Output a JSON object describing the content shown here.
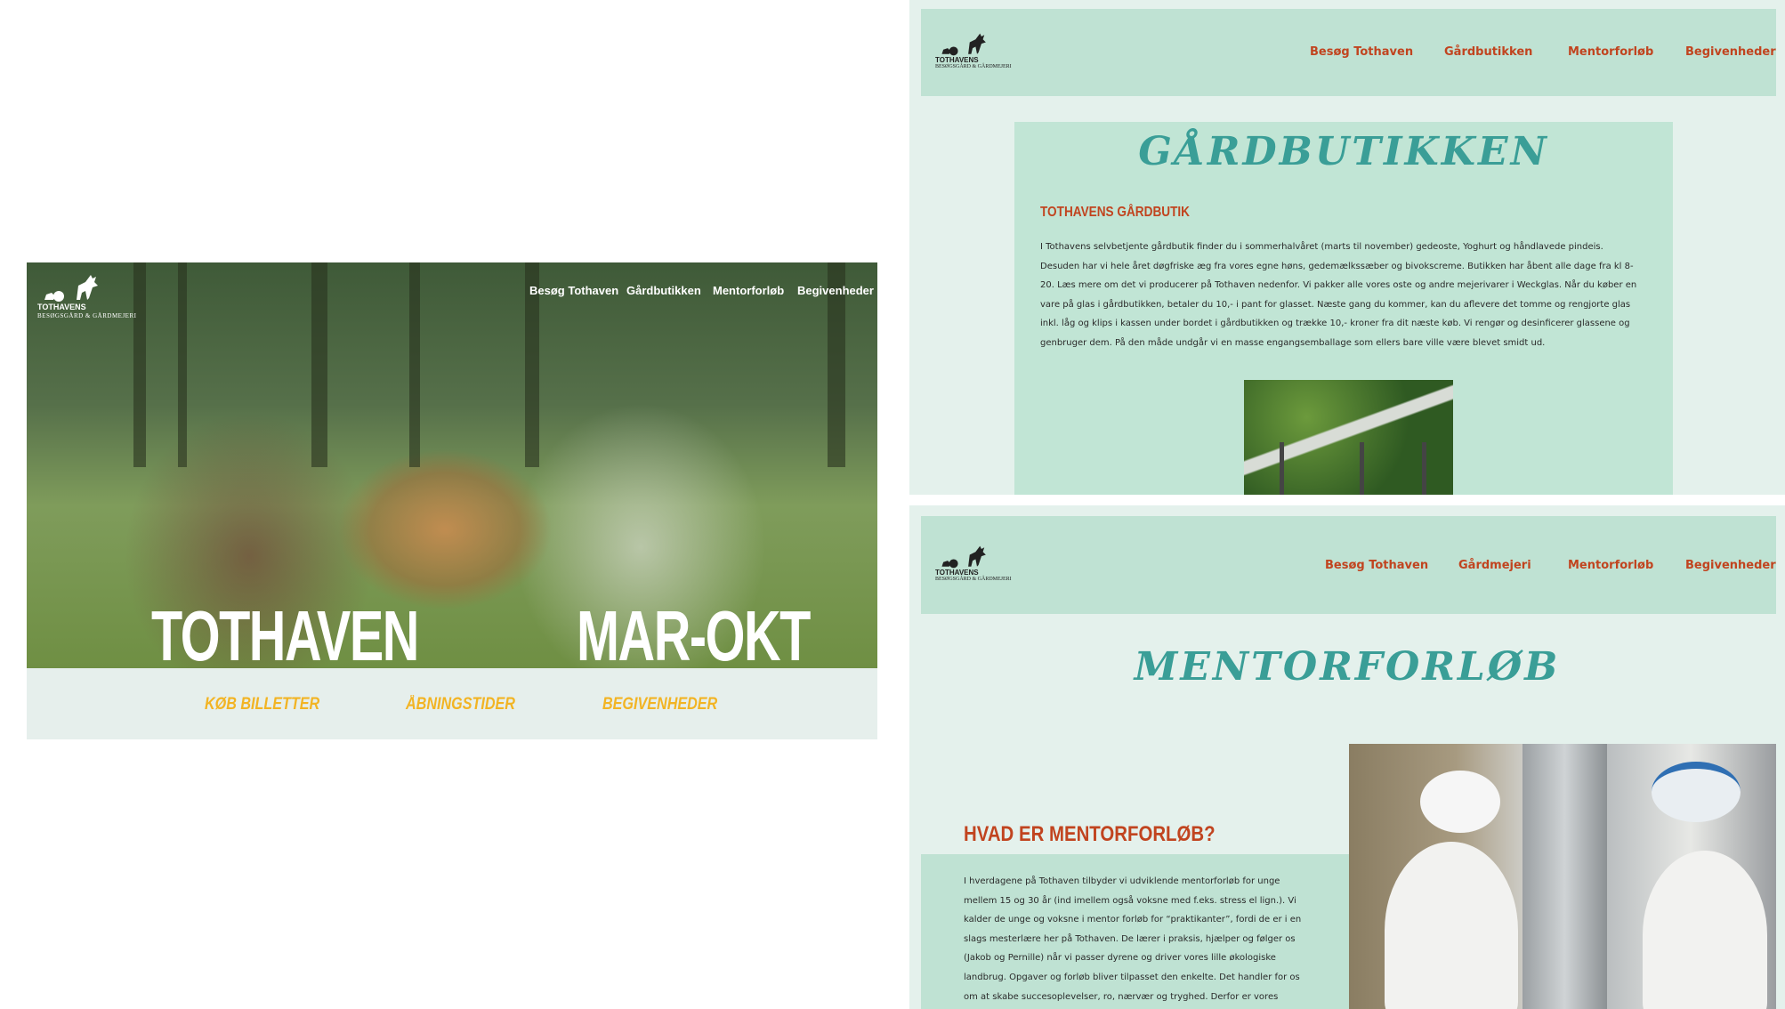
{
  "left_page": {
    "brand": "TOTHAVENS",
    "brand_sub": "BESØGSGÅRD & GÅRDMEJERI",
    "nav": [
      "Besøg Tothaven",
      "Gårdbutikken",
      "Mentorforløb",
      "Begivenheder"
    ],
    "hero_words": [
      "TOTHAVEN",
      "MAR-OKT"
    ],
    "links": [
      "KØB BILLETTER",
      "ÅBNINGSTIDER",
      "BEGIVENHEDER"
    ],
    "colors": {
      "link": "#f2b424",
      "bar": "#e6efec"
    }
  },
  "shop_page": {
    "brand": "TOTHAVENS",
    "brand_sub": "BESØGSGÅRD & GÅRDMEJERI",
    "nav": [
      "Besøg Tothaven",
      "Gårdbutikken",
      "Mentorforløb",
      "Begivenheder"
    ],
    "title": "GÅRDBUTIKKEN",
    "subtitle": "TOTHAVENS GÅRDBUTIK",
    "body": "I Tothavens selvbetjente gårdbutik finder du i sommerhalvåret (marts til november) gedeoste, Yoghurt og håndlavede pindeis. Desuden har vi hele året døgfriske æg fra vores egne høns, gedemælkssæber og bivokscreme.  Butikken har åbent alle dage fra kl 8-20. Læs mere om det vi producerer på Tothaven nedenfor. Vi pakker alle vores oste og andre mejerivarer i Weckglas. Når du køber en vare på glas i gårdbutikken, betaler du 10,- i pant for glasset. Næste gang du kommer, kan du aflevere det tomme og rengjorte glas inkl. låg og klips i kassen under bordet i gårdbutikken og trække 10,- kroner fra dit næste køb. Vi rengør og desinficerer glassene og genbruger dem. På den måde undgår vi en masse engangsemballage som ellers bare ville være blevet smidt ud.",
    "colors": {
      "title": "#3a9e97",
      "accent": "#c1441f",
      "nav_bg": "#bfe2d3",
      "card_bg": "#c1e5d5"
    }
  },
  "mentor_page": {
    "brand": "TOTHAVENS",
    "brand_sub": "BESØGSGÅRD & GÅRDMEJERI",
    "nav": [
      "Besøg Tothaven",
      "Gårdmejeri",
      "Mentorforløb",
      "Begivenheder"
    ],
    "title": "MENTORFORLØB",
    "subtitle": "HVAD ER MENTORFORLØB?",
    "body": "I hverdagene på Tothaven tilbyder vi udviklende mentorforløb for unge mellem 15 og 30 år (ind imellem også voksne med f.eks. stress el lign.). Vi kalder de unge og voksne i mentor forløb for “praktikanter”, fordi de er i en slags mesterlære her på Tothaven. De lærer i praksis, hjælper og følger os (Jakob og Pernille) når vi passer dyrene og driver vores lille økologiske landbrug. Opgaver og forløb bliver tilpasset den enkelte. Det handler for os om at skabe succesoplevelser, ro, nærvær og tryghed. Derfor er vores erfaring også, at det fungerer bedst når der er kun er en"
  }
}
